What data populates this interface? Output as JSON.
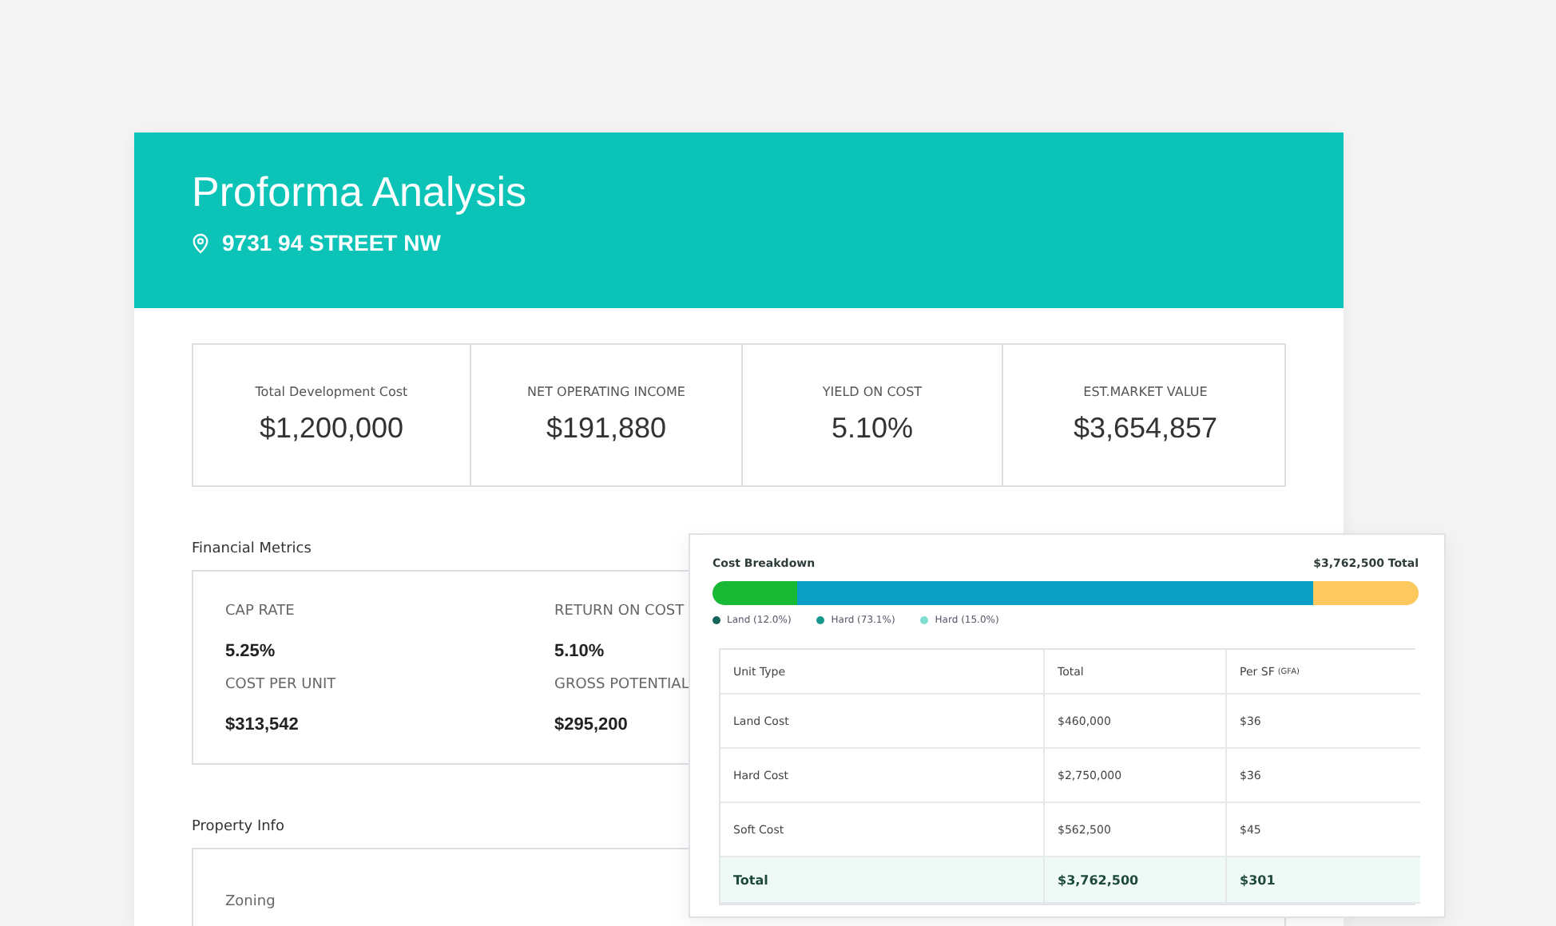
{
  "header": {
    "title": "Proforma Analysis",
    "address": "9731 94 STREET NW"
  },
  "kpis": [
    {
      "label": "Total Development Cost",
      "value": "$1,200,000"
    },
    {
      "label": "NET OPERATING INCOME",
      "value": "$191,880"
    },
    {
      "label": "YIELD ON COST",
      "value": "5.10%"
    },
    {
      "label": "EST.MARKET VALUE",
      "value": "$3,654,857"
    }
  ],
  "financial_metrics": {
    "title": "Financial Metrics",
    "items": [
      {
        "label": "CAP RATE",
        "value": "5.25%"
      },
      {
        "label": "RETURN ON COST",
        "value": "5.10%"
      },
      {
        "label": "COST PER UNIT",
        "value": "$313,542"
      },
      {
        "label": "GROSS POTENTIAL",
        "value": "$295,200"
      }
    ]
  },
  "property_info": {
    "title": "Property Info",
    "items": [
      {
        "label": "Zoning"
      }
    ]
  },
  "cost_breakdown": {
    "title": "Cost Breakdown",
    "total": "$3,762,500 Total",
    "segments": [
      {
        "level": 0.12,
        "color": "#18b934"
      },
      {
        "color": "#0a9ec4"
      },
      {
        "level": 0.149,
        "color": "#fdc95e"
      }
    ],
    "legend": [
      {
        "label": "Land (12.0%)",
        "color": "#15655c"
      },
      {
        "label": "Hard (73.1%)",
        "color": "#18978c"
      },
      {
        "label": "Hard (15.0%)",
        "color": "#80ded1"
      }
    ],
    "columns": [
      {
        "label": "Unit Type"
      },
      {
        "label": "Total"
      },
      {
        "label": "Per SF",
        "note": "(GFA)"
      }
    ],
    "rows": [
      [
        "Land Cost",
        "$460,000",
        "$36"
      ],
      [
        "Hard Cost",
        "$2,750,000",
        "$36"
      ],
      [
        "Soft Cost",
        "$562,500",
        "$45"
      ]
    ],
    "total_row": [
      "Total",
      "$3,762,500",
      "$301"
    ]
  }
}
